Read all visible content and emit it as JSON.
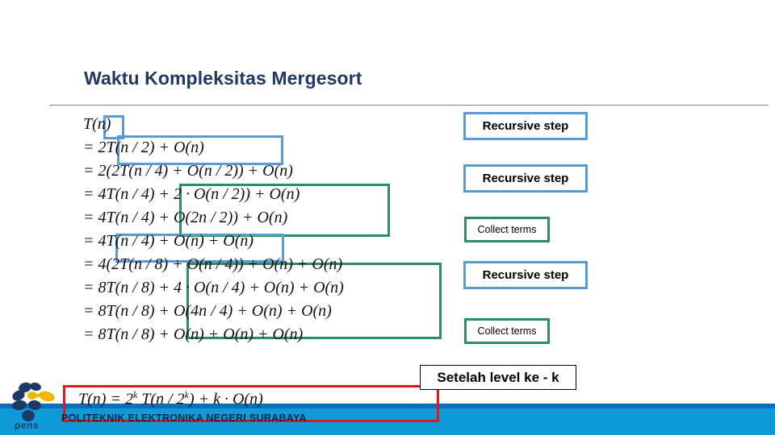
{
  "slide": {
    "title": "Waktu Kompleksitas Mergesort",
    "background_color": "#ffffff"
  },
  "colors": {
    "title": "#1f3864",
    "highlight_blue": "#5b9bd5",
    "highlight_green": "#2e8b62",
    "highlight_red": "#e8141a",
    "footer_banner": "#0e9bd8",
    "footer_banner_top": "#0b6fb8",
    "footer_text": "#0b2545",
    "rule": "#808080"
  },
  "equations": [
    {
      "id": "line-1",
      "text": "T(n)"
    },
    {
      "id": "line-2",
      "text": "= 2T(n / 2) + O(n)"
    },
    {
      "id": "line-3",
      "text": "= 2(2T(n / 4) + O(n / 2)) + O(n)"
    },
    {
      "id": "line-4",
      "text": "= 4T(n / 4) + 2 · O(n / 2)) + O(n)"
    },
    {
      "id": "line-5",
      "text": "= 4T(n / 4) + O(2n / 2)) + O(n)"
    },
    {
      "id": "line-6",
      "text": "= 4T(n / 4) + O(n) + O(n)"
    },
    {
      "id": "line-7",
      "text": "= 4(2T(n / 8) + O(n / 4)) + O(n) + O(n)"
    },
    {
      "id": "line-8",
      "text": "= 8T(n / 8) + 4 · O(n / 4) + O(n) + O(n)"
    },
    {
      "id": "line-9",
      "text": "= 8T(n / 8) + O(4n / 4) + O(n) + O(n)"
    },
    {
      "id": "line-10",
      "text": "= 8T(n / 8) + O(n) + O(n) + O(n)"
    }
  ],
  "final_formula": {
    "text": "T(n) = 2^k T(n / 2^k) + k · O(n)",
    "base": "T(n) = 2",
    "exp1": "k",
    "mid": "T(n / 2",
    "exp2": "k",
    "tail": ") + k · O(n)"
  },
  "callouts": [
    {
      "id": "recursive-step-1",
      "label": "Recursive step",
      "style": "blue"
    },
    {
      "id": "recursive-step-2",
      "label": "Recursive step",
      "style": "blue"
    },
    {
      "id": "collect-terms-1",
      "label": "Collect terms",
      "style": "green"
    },
    {
      "id": "recursive-step-3",
      "label": "Recursive step",
      "style": "blue"
    },
    {
      "id": "collect-terms-2",
      "label": "Collect terms",
      "style": "green"
    },
    {
      "id": "setelah-level",
      "label": "Setelah level ke - k",
      "style": "plain"
    }
  ],
  "footer": {
    "institution": "POLITEKNIK ELEKTRONIKA NEGERI SURABAYA",
    "logo_text": "pens"
  }
}
